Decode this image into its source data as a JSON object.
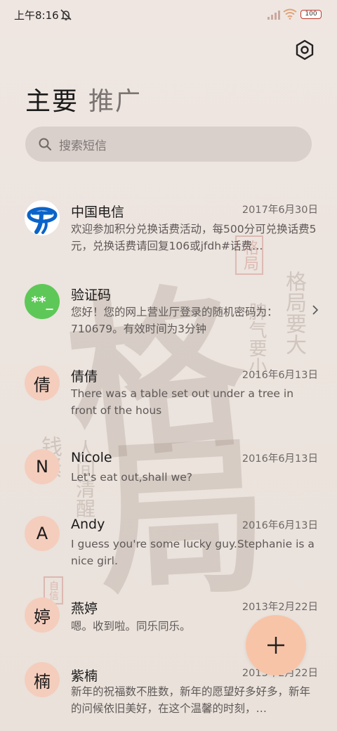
{
  "status_bar": {
    "time": "上午8:16",
    "battery": "100"
  },
  "tabs": [
    {
      "label": "主要"
    },
    {
      "label": "推广"
    }
  ],
  "search": {
    "placeholder": "搜索短信"
  },
  "conversations": [
    {
      "name": "中国电信",
      "date": "2017年6月30日",
      "preview": "欢迎参加积分兑换话费活动，每500分可兑换话费5元，兑换话费请回复106或jfdh#话费…",
      "avatar": "telecom-logo"
    },
    {
      "name": "验证码",
      "date": "",
      "preview": "您好！您的网上营业厅登录的随机密码为：710679。有效时间为3分钟",
      "avatar_text": "**_"
    },
    {
      "name": "倩倩",
      "date": "2016年6月13日",
      "preview": "There was a table set out under a tree in front of the hous",
      "avatar_text": "倩"
    },
    {
      "name": "Nicole",
      "date": "2016年6月13日",
      "preview": "Let's eat out,shall we?",
      "avatar_text": "N"
    },
    {
      "name": "Andy",
      "date": "2016年6月13日",
      "preview": "I guess you're some lucky guy.Stephanie is a nice girl.",
      "avatar_text": "A"
    },
    {
      "name": "燕婷",
      "date": "2013年2月22日",
      "preview": "嗯。收到啦。同乐同乐。",
      "avatar_text": "婷"
    },
    {
      "name": "紫楠",
      "date": "2013年2月22日",
      "preview": "新年的祝福数不胜数，新年的愿望好多好多，新年的问候依旧美好，在这个温馨的时刻，…",
      "avatar_text": "楠"
    }
  ],
  "wallpaper": {
    "big1": "格",
    "big2": "局",
    "col1": "格局要大",
    "col2": "脾气要小",
    "col3": "钱紧",
    "col4": "人间清醒",
    "seal1": "格局",
    "seal2": "自信"
  },
  "colors": {
    "accent_fab": "#f8c4a8",
    "avatar_bg": "#f4cdbd",
    "code_avatar": "#5dc857",
    "telecom_blue": "#0a63c9"
  },
  "icons": [
    "mute-icon",
    "signal-icon",
    "wifi-icon",
    "battery-icon",
    "settings-icon",
    "search-icon",
    "chevron-right-icon",
    "plus-icon"
  ]
}
